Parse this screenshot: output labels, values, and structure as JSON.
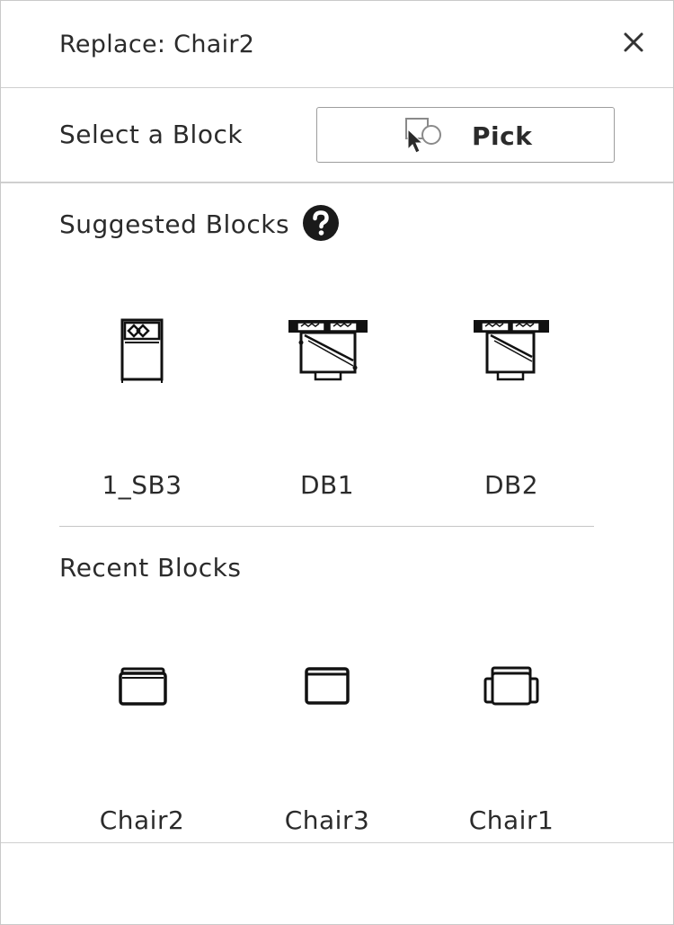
{
  "dialog": {
    "title": "Replace: Chair2",
    "close_icon": "close-icon"
  },
  "select_block": {
    "label": "Select a Block",
    "pick_button_label": "Pick",
    "pick_icon": "pick-block-icon"
  },
  "suggested": {
    "title": "Suggested Blocks",
    "help_icon": "question-circle-icon",
    "items": [
      {
        "label": "1_SB3",
        "icon": "single-bed-block-icon"
      },
      {
        "label": "DB1",
        "icon": "double-bed-block-icon"
      },
      {
        "label": "DB2",
        "icon": "double-bed-block-icon"
      }
    ]
  },
  "recent": {
    "title": "Recent Blocks",
    "items": [
      {
        "label": "Chair2",
        "icon": "chair-block-icon"
      },
      {
        "label": "Chair3",
        "icon": "chair-block-icon"
      },
      {
        "label": "Chair1",
        "icon": "armchair-block-icon"
      }
    ]
  }
}
